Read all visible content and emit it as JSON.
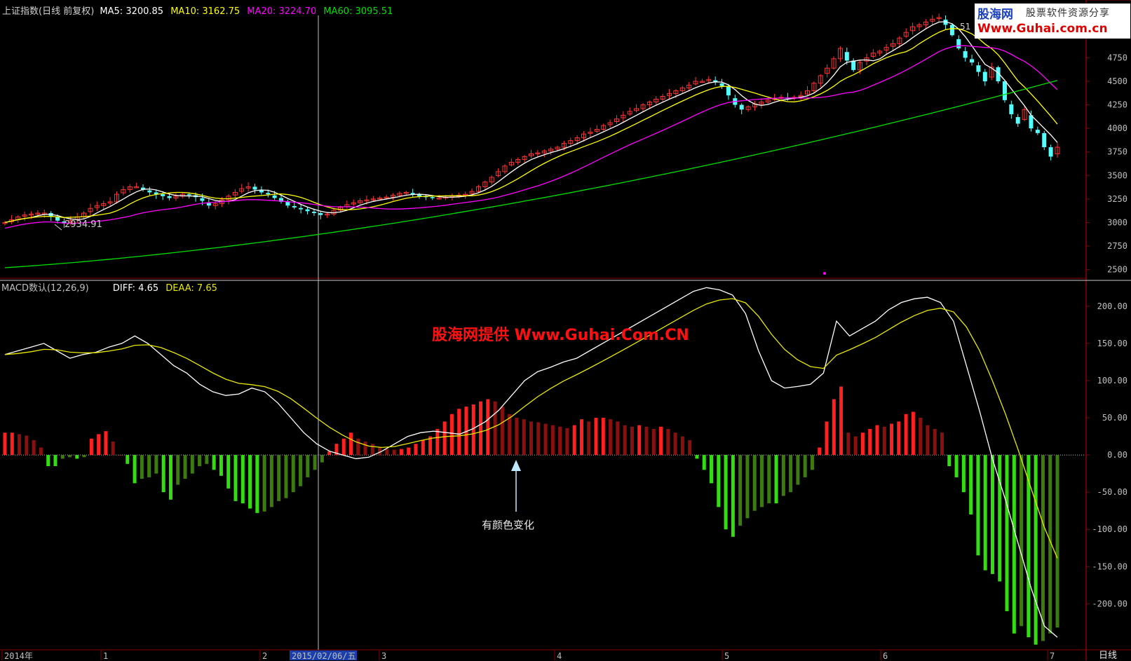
{
  "header": {
    "price_title": "上证指数(日线 前复权)",
    "ma5": "MA5: 3200.85",
    "ma10": "MA10: 3162.75",
    "ma20": "MA20: 3224.70",
    "ma60": "MA60: 3095.51",
    "macd_title": "MACD数认(12,26,9)",
    "diff": "DIFF: 4.65",
    "dea": "DEAA: 7.65",
    "bottom_right_label": "日线"
  },
  "logo": {
    "line1_left": "股海网",
    "line1_right": "股票软件资源分享",
    "line2": "Www.Guhai.com.cn"
  },
  "watermark": "股海网提供 Www.Guhai.Com.CN",
  "annotation": {
    "text": "有颜色变化"
  },
  "price_marks": {
    "low_label": "2934.91",
    "high_label": "51"
  },
  "x_axis": {
    "labels": [
      "2014年",
      "1",
      "2",
      "2015/02/06/五",
      "3",
      "4",
      "5",
      "6",
      "7"
    ]
  },
  "colors": {
    "background": "#000000",
    "up_candle": "#ff3333",
    "down_candle": "#54ffff",
    "ma5": "#ffffff",
    "ma10": "#ffff00",
    "ma20": "#ff00ff",
    "ma60": "#00e000",
    "macd_pos": "#ff2020",
    "macd_pos_dim": "#8a1010",
    "macd_neg": "#33dd11",
    "macd_neg_dim": "#3d7a10",
    "diff": "#ffffff",
    "dea": "#e8e800",
    "grid": "#8a0000",
    "watermark": "#ff1010"
  },
  "chart_data": [
    {
      "type": "candlestick",
      "title": "上证指数(日线 前复权)",
      "ylim": [
        2400,
        5200
      ],
      "yticks": [
        2500,
        2750,
        3000,
        3250,
        3500,
        3750,
        4000,
        4250,
        4500,
        4750
      ],
      "x_labels": [
        "2014年",
        "1",
        "2",
        "2015/02/06/五",
        "3",
        "4",
        "5",
        "6",
        "7"
      ],
      "close_path": [
        3000,
        3030,
        3060,
        3080,
        3090,
        3100,
        3100,
        3060,
        3020,
        2990,
        3020,
        3060,
        3100,
        3150,
        3180,
        3200,
        3220,
        3300,
        3350,
        3380,
        3380,
        3350,
        3320,
        3300,
        3280,
        3260,
        3280,
        3300,
        3290,
        3270,
        3230,
        3180,
        3200,
        3240,
        3280,
        3320,
        3360,
        3380,
        3350,
        3320,
        3300,
        3260,
        3220,
        3180,
        3160,
        3140,
        3120,
        3100,
        3080,
        3090,
        3130,
        3160,
        3190,
        3210,
        3230,
        3240,
        3250,
        3260,
        3270,
        3290,
        3310,
        3320,
        3300,
        3280,
        3270,
        3260,
        3260,
        3270,
        3280,
        3290,
        3300,
        3330,
        3380,
        3430,
        3480,
        3540,
        3600,
        3640,
        3670,
        3700,
        3730,
        3740,
        3760,
        3780,
        3800,
        3840,
        3870,
        3900,
        3940,
        3960,
        3990,
        4030,
        4060,
        4100,
        4140,
        4180,
        4210,
        4250,
        4280,
        4310,
        4340,
        4370,
        4400,
        4430,
        4460,
        4500,
        4500,
        4520,
        4490,
        4450,
        4350,
        4250,
        4200,
        4230,
        4260,
        4280,
        4300,
        4320,
        4330,
        4320,
        4330,
        4350,
        4400,
        4480,
        4560,
        4640,
        4740,
        4850,
        4720,
        4620,
        4700,
        4750,
        4800,
        4820,
        4860,
        4900,
        4960,
        5020,
        5080,
        5100,
        5130,
        5160,
        5178,
        5100,
        4990,
        4850,
        4750,
        4700,
        4600,
        4500,
        4650,
        4500,
        4300,
        4150,
        4050,
        4200,
        4000,
        3950,
        3800,
        3700,
        3800
      ],
      "ma60_range": [
        2520,
        4510
      ],
      "low_mark": 2934.91
    },
    {
      "type": "macd",
      "title": "MACD数认(12,26,9)",
      "ylim": [
        -260,
        230
      ],
      "yticks": [
        200,
        150,
        100,
        50,
        0,
        -50,
        -100,
        -150,
        -200
      ],
      "diff_last": 4.65,
      "dea_last": 7.65,
      "histogram": [
        30,
        30,
        28,
        26,
        20,
        10,
        -15,
        -15,
        -5,
        -3,
        -5,
        -3,
        22,
        28,
        32,
        18,
        0,
        -12,
        -38,
        -32,
        -30,
        -25,
        -50,
        -60,
        -40,
        -32,
        -25,
        -15,
        -12,
        -20,
        -28,
        -45,
        -62,
        -65,
        -72,
        -78,
        -76,
        -70,
        -62,
        -58,
        -50,
        -42,
        -30,
        -20,
        -10,
        5,
        15,
        22,
        30,
        22,
        18,
        15,
        10,
        8,
        7,
        8,
        10,
        15,
        20,
        25,
        35,
        45,
        55,
        62,
        65,
        68,
        72,
        75,
        72,
        65,
        55,
        50,
        48,
        45,
        44,
        42,
        40,
        38,
        36,
        40,
        48,
        45,
        50,
        50,
        48,
        45,
        40,
        38,
        40,
        38,
        35,
        38,
        35,
        30,
        25,
        20,
        -5,
        -20,
        -38,
        -70,
        -100,
        -110,
        -95,
        -85,
        -75,
        -70,
        -65,
        -65,
        -55,
        -50,
        -40,
        -30,
        -20,
        10,
        45,
        75,
        92,
        30,
        25,
        30,
        35,
        40,
        38,
        42,
        45,
        55,
        58,
        50,
        40,
        35,
        30,
        -15,
        -30,
        -50,
        -80,
        -135,
        -155,
        -160,
        -170,
        -210,
        -240,
        -230,
        -245,
        -255,
        -250,
        -240,
        -232
      ],
      "diff_path": [
        135,
        140,
        145,
        150,
        140,
        130,
        135,
        138,
        145,
        150,
        160,
        150,
        135,
        120,
        110,
        95,
        85,
        80,
        82,
        90,
        85,
        70,
        50,
        30,
        15,
        5,
        0,
        -5,
        -3,
        5,
        15,
        25,
        30,
        32,
        30,
        28,
        35,
        45,
        60,
        80,
        100,
        112,
        118,
        125,
        130,
        140,
        150,
        160,
        170,
        180,
        190,
        200,
        210,
        220,
        225,
        222,
        215,
        190,
        140,
        100,
        90,
        92,
        95,
        110,
        180,
        160,
        170,
        180,
        195,
        205,
        210,
        212,
        205,
        180,
        120,
        60,
        -5,
        -60,
        -120,
        -180,
        -230,
        -245
      ]
    }
  ]
}
